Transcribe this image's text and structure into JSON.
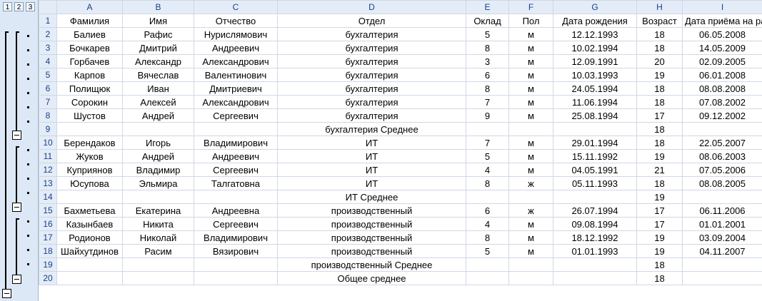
{
  "outline": {
    "levels": [
      "1",
      "2",
      "3"
    ]
  },
  "columns": [
    "A",
    "B",
    "C",
    "D",
    "E",
    "F",
    "G",
    "H",
    "I"
  ],
  "rows": [
    {
      "n": "1",
      "cells": [
        "Фамилия",
        "Имя",
        "Отчество",
        "Отдел",
        "Оклад",
        "Пол",
        "Дата рождения",
        "Возраст",
        "Дата приёма на работу"
      ]
    },
    {
      "n": "2",
      "cells": [
        "Балиев",
        "Рафис",
        "Нурислямович",
        "бухгалтерия",
        "5",
        "м",
        "12.12.1993",
        "18",
        "06.05.2008"
      ]
    },
    {
      "n": "3",
      "cells": [
        "Бочкарев",
        "Дмитрий",
        "Андреевич",
        "бухгалтерия",
        "8",
        "м",
        "10.02.1994",
        "18",
        "14.05.2009"
      ]
    },
    {
      "n": "4",
      "cells": [
        "Горбачев",
        "Александр",
        "Александрович",
        "бухгалтерия",
        "3",
        "м",
        "12.09.1991",
        "20",
        "02.09.2005"
      ]
    },
    {
      "n": "5",
      "cells": [
        "Карпов",
        "Вячеслав",
        "Валентинович",
        "бухгалтерия",
        "6",
        "м",
        "10.03.1993",
        "19",
        "06.01.2008"
      ]
    },
    {
      "n": "6",
      "cells": [
        "Полищюк",
        "Иван",
        "Дмитриевич",
        "бухгалтерия",
        "8",
        "м",
        "24.05.1994",
        "18",
        "08.08.2008"
      ]
    },
    {
      "n": "7",
      "cells": [
        "Сорокин",
        "Алексей",
        "Александрович",
        "бухгалтерия",
        "7",
        "м",
        "11.06.1994",
        "18",
        "07.08.2002"
      ]
    },
    {
      "n": "8",
      "cells": [
        "Шустов",
        "Андрей",
        "Сергеевич",
        "бухгалтерия",
        "9",
        "м",
        "25.08.1994",
        "17",
        "09.12.2002"
      ]
    },
    {
      "n": "9",
      "cells": [
        "",
        "",
        "",
        "бухгалтерия Среднее",
        "",
        "",
        "",
        "18",
        ""
      ],
      "subtotal": true
    },
    {
      "n": "10",
      "cells": [
        "Берендаков",
        "Игорь",
        "Владимирович",
        "ИТ",
        "7",
        "м",
        "29.01.1994",
        "18",
        "22.05.2007"
      ]
    },
    {
      "n": "11",
      "cells": [
        "Жуков",
        "Андрей",
        "Андреевич",
        "ИТ",
        "5",
        "м",
        "15.11.1992",
        "19",
        "08.06.2003"
      ]
    },
    {
      "n": "12",
      "cells": [
        "Куприянов",
        "Владимир",
        "Сергеевич",
        "ИТ",
        "4",
        "м",
        "04.05.1991",
        "21",
        "07.05.2006"
      ]
    },
    {
      "n": "13",
      "cells": [
        "Юсупова",
        "Эльмира",
        "Талгатовна",
        "ИТ",
        "8",
        "ж",
        "05.11.1993",
        "18",
        "08.08.2005"
      ]
    },
    {
      "n": "14",
      "cells": [
        "",
        "",
        "",
        "ИТ Среднее",
        "",
        "",
        "",
        "19",
        ""
      ],
      "subtotal": true
    },
    {
      "n": "15",
      "cells": [
        "Бахметьева",
        "Екатерина",
        "Андреевна",
        "производственный",
        "6",
        "ж",
        "26.07.1994",
        "17",
        "06.11.2006"
      ]
    },
    {
      "n": "16",
      "cells": [
        "Казынбаев",
        "Никита",
        "Сергеевич",
        "производственный",
        "4",
        "м",
        "09.08.1994",
        "17",
        "01.01.2001"
      ]
    },
    {
      "n": "17",
      "cells": [
        "Родионов",
        "Николай",
        "Владимирович",
        "производственный",
        "8",
        "м",
        "18.12.1992",
        "19",
        "03.09.2004"
      ]
    },
    {
      "n": "18",
      "cells": [
        "Шайхутдинов",
        "Расим",
        "Вязирович",
        "производственный",
        "5",
        "м",
        "01.01.1993",
        "19",
        "04.11.2007"
      ]
    },
    {
      "n": "19",
      "cells": [
        "",
        "",
        "",
        "производственный Среднее",
        "",
        "",
        "",
        "18",
        ""
      ],
      "subtotal": true
    },
    {
      "n": "20",
      "cells": [
        "",
        "",
        "",
        "Общее среднее",
        "",
        "",
        "",
        "18",
        ""
      ],
      "subtotal": true
    }
  ]
}
